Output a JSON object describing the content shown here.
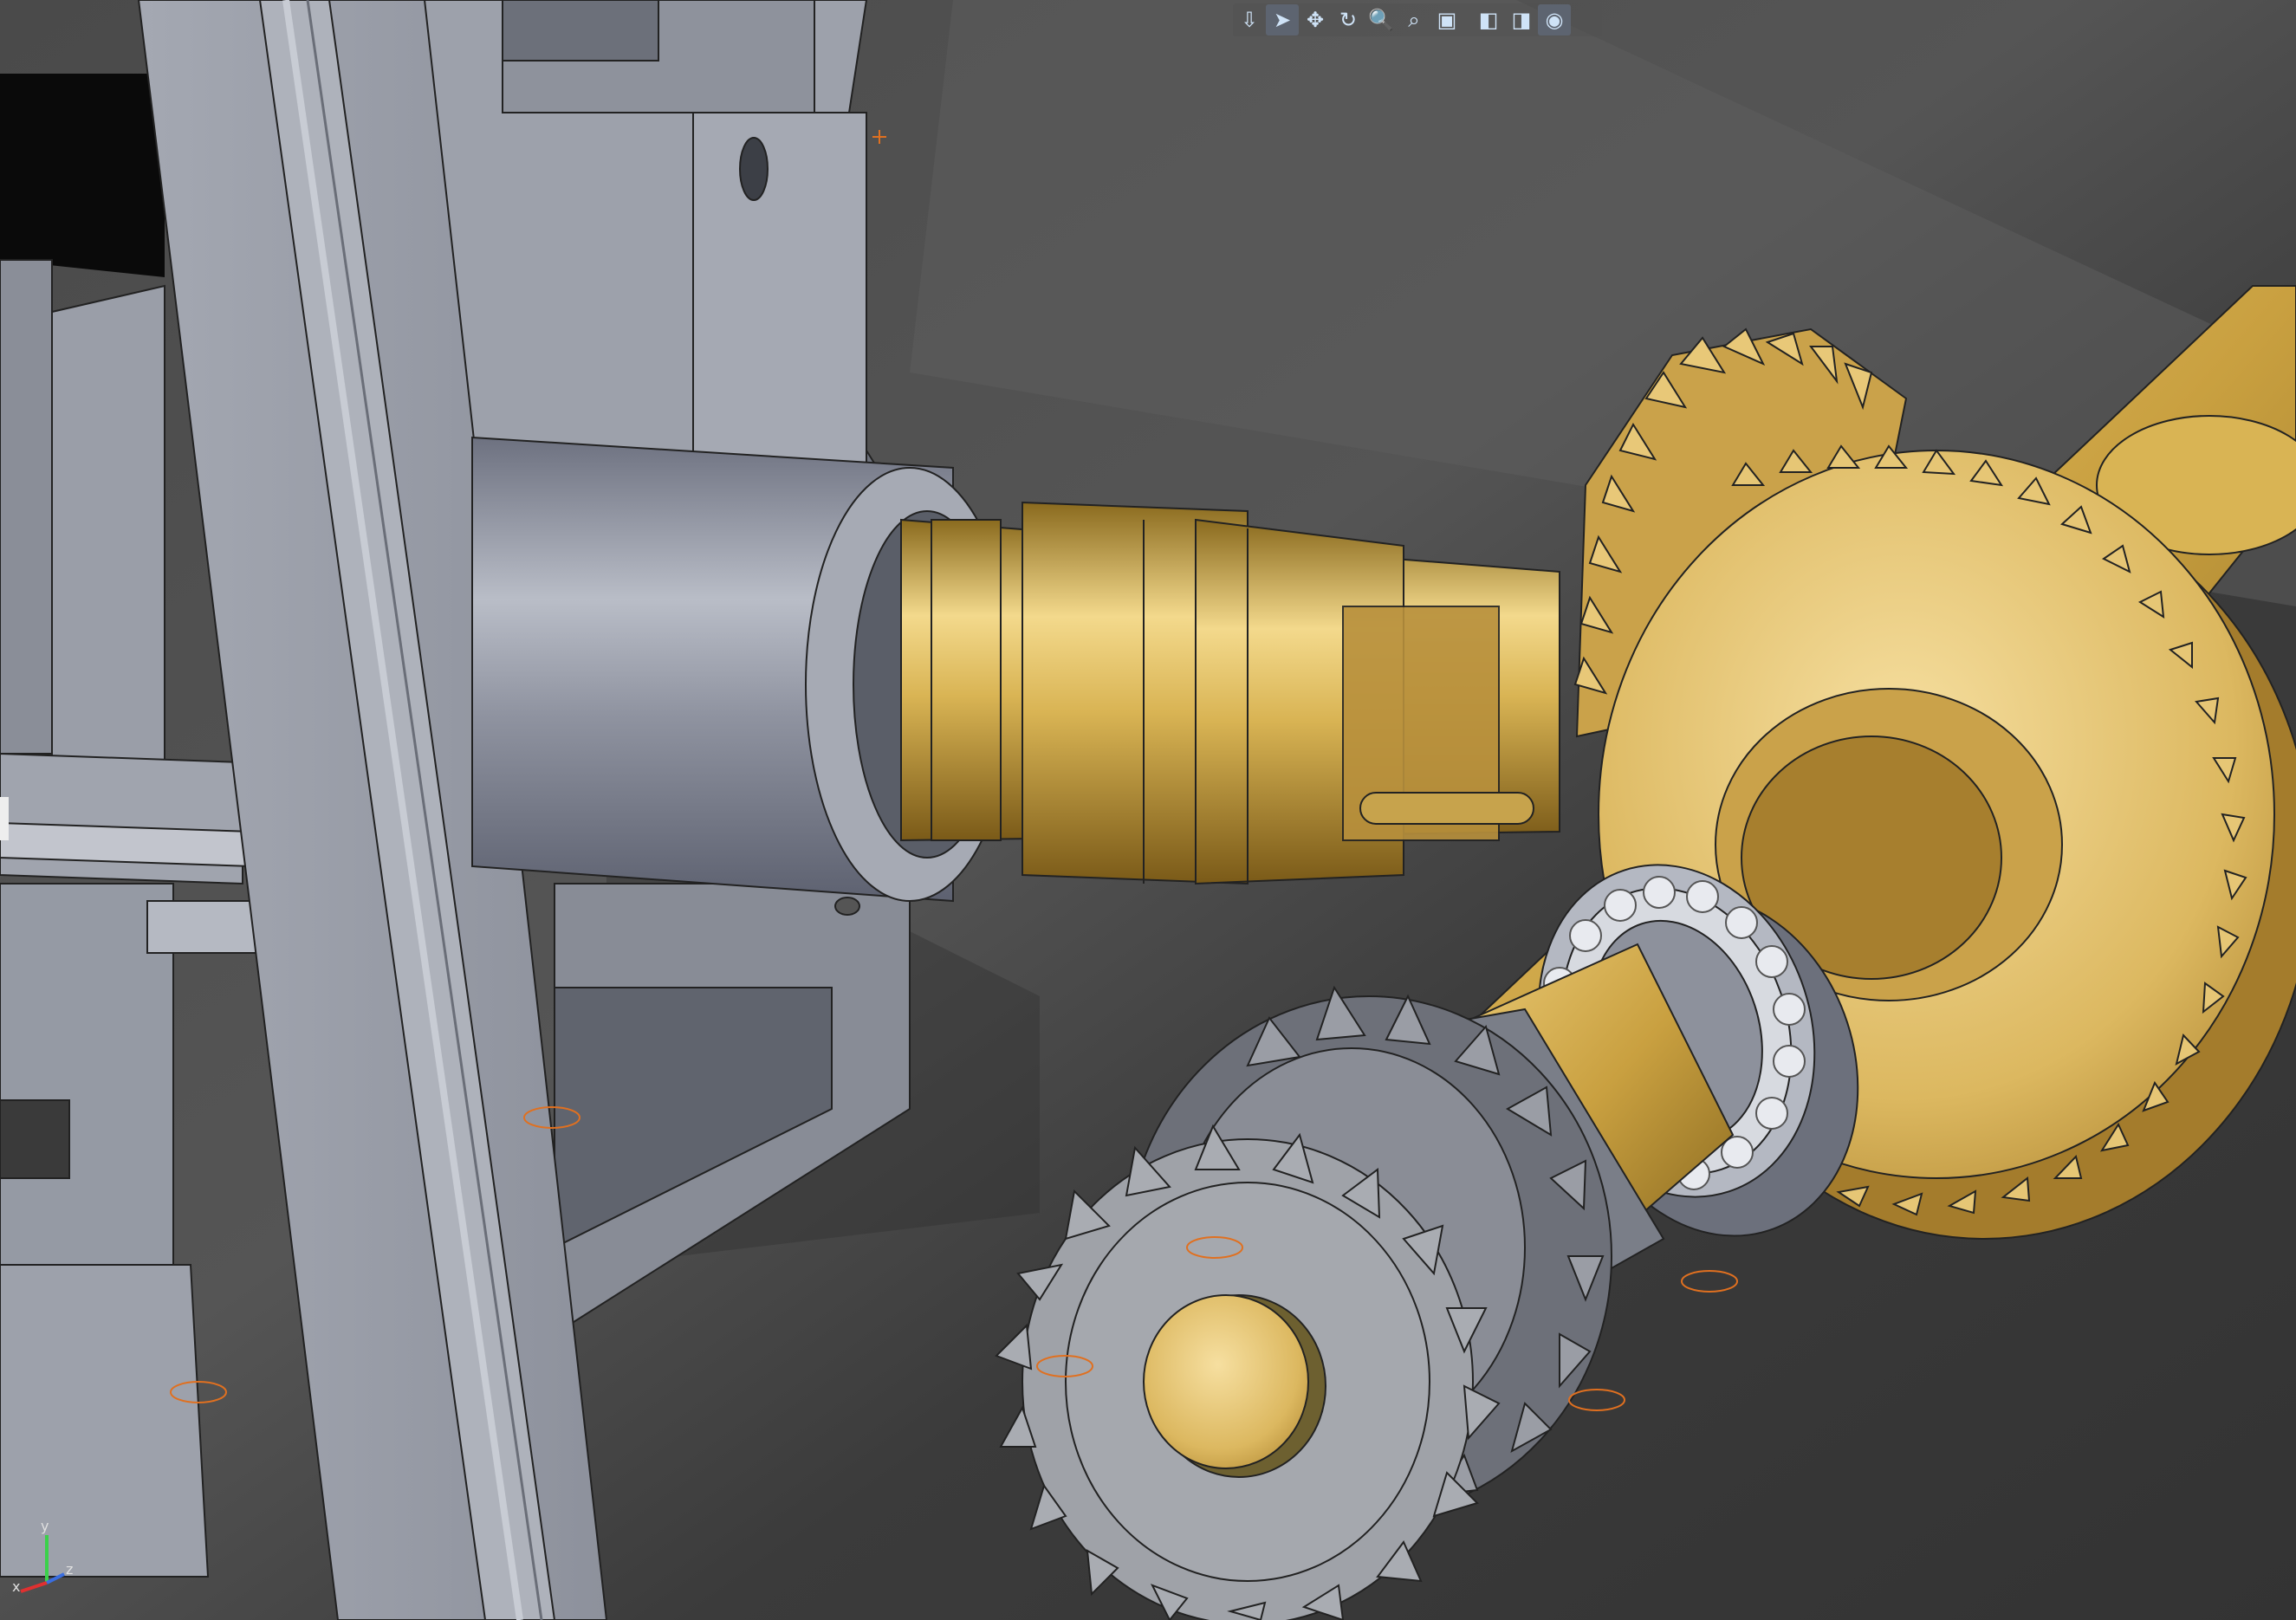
{
  "window": {
    "title": ""
  },
  "view_toolbar": {
    "buttons": [
      {
        "name": "view-orientation",
        "glyph": "⇩"
      },
      {
        "name": "select",
        "glyph": "➤",
        "active": true
      },
      {
        "name": "pan",
        "glyph": "✥"
      },
      {
        "name": "rotate",
        "glyph": "↻"
      },
      {
        "name": "zoom-in-out",
        "glyph": "🔍"
      },
      {
        "name": "zoom-area",
        "glyph": "⌕"
      },
      {
        "name": "zoom-fit",
        "glyph": "▣"
      },
      {
        "name": "view-cube",
        "glyph": "◧"
      },
      {
        "name": "display-style",
        "glyph": "◨"
      },
      {
        "name": "hide-show",
        "glyph": "◉"
      }
    ],
    "colors": {
      "icon": "#cfe3f7",
      "active_bg": "#5d6470"
    }
  },
  "triad": {
    "x_label": "x",
    "y_label": "y",
    "z_label": "z"
  },
  "scene": {
    "description_colors": {
      "background_dark": "#3a3a3a",
      "background_light": "#5a5a5a",
      "frame_gray": "#9a9ea8",
      "brass": "#c9a040",
      "steel": "#7e8088",
      "highlight_orange": "#e07020"
    },
    "objects": [
      "frame-plate",
      "housing-block",
      "bearing-sleeve",
      "brass-shaft",
      "bevel-gear",
      "spur-gear",
      "ball-bearing",
      "sprocket-large",
      "sprocket-small",
      "main-brass-shaft"
    ]
  }
}
